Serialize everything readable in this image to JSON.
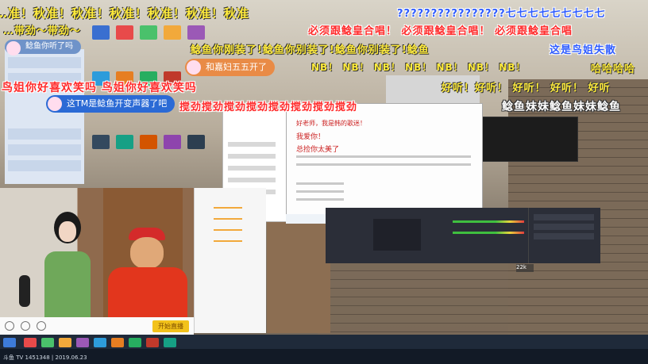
{
  "danmaku": {
    "top_row": "…准！秋准！秋准！秋准！秋准！秋准！秋准",
    "question_marks": "????????????????七七七七七七七七七",
    "tone_row": "…带劲～带劲～",
    "hutao": "必须跟鲶皇合唱！ 必须跟鲶皇合唱！ 必须跟鲶皇合唱",
    "fake_sound": "鲶鱼你刚装了!鲶鱼你别装了!鲶鱼你别装了!鲶鱼",
    "nb_row": "NB！ NB！ NB！ NB！ NB！ NB！ NB！",
    "fake_right": "这是鸟姐失散",
    "haha": "哈哈哈哈",
    "sister_laugh": "鸟姐你好喜欢笑吗 鸟姐你好喜欢笑吗",
    "hao_row": "好听！好听！ 好听！ 好听！ 好听",
    "spin_row": "搅劲搅劲搅劲搅劲搅劲搅劲搅劲搅劲",
    "fish_sister": "鲶鱼妹妹鲶鱼妹妹鲶鱼",
    "fish_kong": "鲶鱼你听了吗",
    "heyu": "和嘉妇五五开了",
    "tm_voice": "这TM是鲶鱼开变声器了吧"
  },
  "doc": {
    "line1": "好老师，我是韩的歌迷！",
    "line2": "我爱你！",
    "line3": "总捡你太美了"
  },
  "webcam": {
    "start_button": "开始直播"
  },
  "viewer_badge": "22k",
  "watermark": "斗鱼 TV 1451348 | 2019.06.23"
}
